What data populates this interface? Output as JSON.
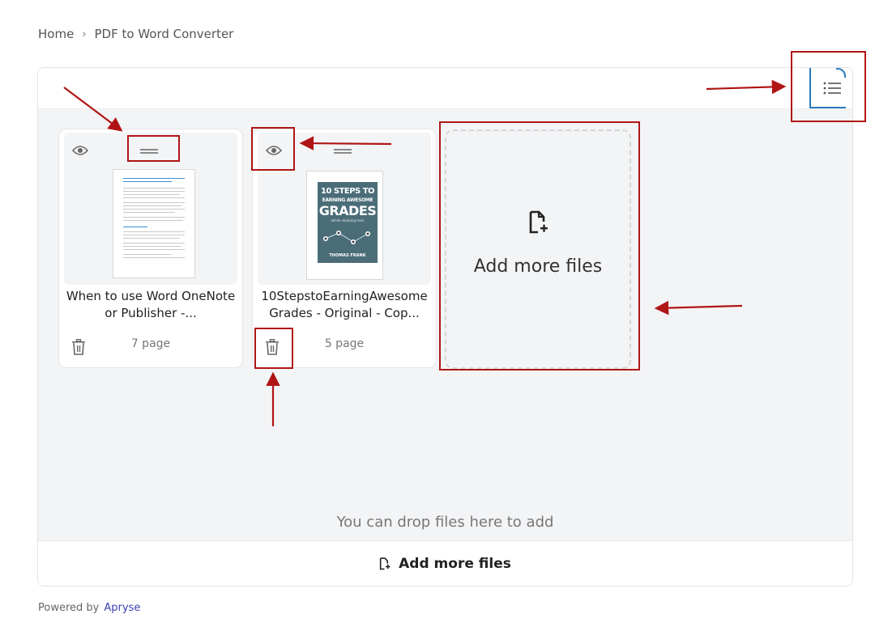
{
  "breadcrumb": {
    "home": "Home",
    "separator": "›",
    "current": "PDF to Word Converter"
  },
  "files": [
    {
      "title": "When to use Word OneNote or Publisher -...",
      "pages": "7 page"
    },
    {
      "title": "10StepstoEarningAwesomeGrades - Original - Cop...",
      "pages": "5 page",
      "cover": {
        "line1": "10 STEPS TO",
        "line2": "EARNING AWESOME",
        "line3": "GRADES",
        "subtitle": "(while studying less)",
        "author": "THOMAS FRANK",
        "color": "#4a6d78"
      }
    }
  ],
  "add_tile_label": "Add more files",
  "drop_hint": "You can drop files here to add",
  "bottom_button_label": "Add more files",
  "footer": {
    "powered_by": "Powered by",
    "brand": "Apryse"
  },
  "colors": {
    "accent": "#2a7bbf",
    "annotation": "#b01515",
    "brand": "#3b3fb0"
  },
  "icons": {
    "view_toggle": "list-view-icon",
    "preview": "eye-icon",
    "drag": "drag-handle-icon",
    "delete": "trash-icon",
    "add_file": "file-add-icon"
  }
}
